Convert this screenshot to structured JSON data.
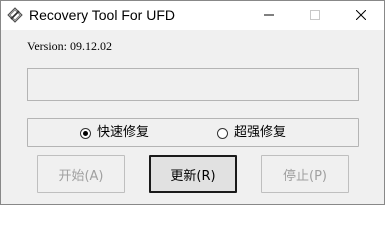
{
  "window": {
    "title": "Recovery Tool For UFD",
    "icon": "diamond-app-icon",
    "controls": {
      "minimize_icon": "minimize-icon",
      "maximize_icon": "maximize-icon",
      "close_icon": "close-icon"
    }
  },
  "version_label": "Version: 09.12.02",
  "status_text": "",
  "mode": {
    "options": [
      {
        "label": "快速修复",
        "selected": true
      },
      {
        "label": "超强修复",
        "selected": false
      }
    ]
  },
  "buttons": {
    "start": {
      "label": "开始(A)",
      "enabled": false
    },
    "update": {
      "label": "更新(R)",
      "enabled": true,
      "default": true
    },
    "stop": {
      "label": "停止(P)",
      "enabled": false
    }
  },
  "colors": {
    "window_bg": "#f0f0f0",
    "titlebar_bg": "#ffffff",
    "disabled_text": "#a0a0a0",
    "border": "#b4b4b4"
  }
}
